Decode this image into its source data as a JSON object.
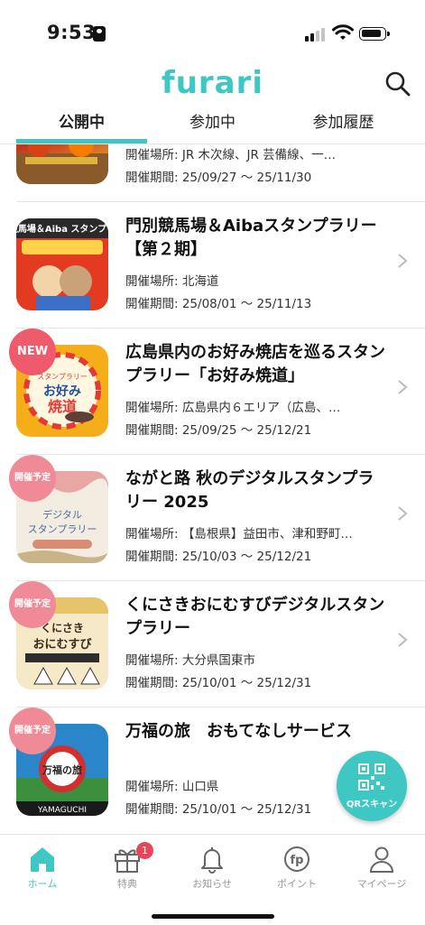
{
  "status_bar": {
    "time": "9:53"
  },
  "header": {
    "logo": "furari"
  },
  "tabs": [
    {
      "label": "公開中",
      "active": true
    },
    {
      "label": "参加中",
      "active": false
    },
    {
      "label": "参加履歴",
      "active": false
    }
  ],
  "rallies": [
    {
      "title": "",
      "place": "開催場所: JR 木次線、JR 芸備線、一…",
      "period": "開催期間: 25/09/27 〜 25/11/30",
      "badge": ""
    },
    {
      "title": "門別競馬場＆Aibaスタンプラリー【第２期】",
      "place": "開催場所: 北海道",
      "period": "開催期間: 25/08/01 〜 25/11/13",
      "badge": "",
      "thumb_text": "門別競馬場＆Aiba スタンプラリー"
    },
    {
      "title": "広島県内のお好み焼店を巡るスタンプラリー「お好み焼道」",
      "place": "開催場所: 広島県内６エリア（広島、…",
      "period": "開催期間: 25/09/25 〜 25/12/21",
      "badge": "NEW",
      "thumb_text": "スタンプラリー お好み焼道"
    },
    {
      "title": "ながと路 秋のデジタルスタンプラリー 2025",
      "place": "開催場所: 【島根県】益田市、津和野町…",
      "period": "開催期間: 25/10/03 〜 25/12/21",
      "badge": "開催予定",
      "thumb_text": "デジタル スタンプラリー"
    },
    {
      "title": "くにさきおにむすびデジタルスタンプラリー",
      "place": "開催場所: 大分県国東市",
      "period": "開催期間: 25/10/01 〜 25/12/31",
      "badge": "開催予定",
      "thumb_text": "くにさき おにむすび"
    },
    {
      "title": "万福の旅　おもてなしサービス",
      "place": "開催場所: 山口県",
      "period": "開催期間: 25/10/01 〜 25/12/31",
      "badge": "開催予定",
      "thumb_text": "万福の旅 YAMAGUCHI"
    }
  ],
  "qr_button": {
    "label": "QRスキャン"
  },
  "bottom_nav": [
    {
      "label": "ホーム",
      "icon": "home-icon",
      "active": true
    },
    {
      "label": "特典",
      "icon": "gift-icon",
      "badge": "1"
    },
    {
      "label": "お知らせ",
      "icon": "bell-icon"
    },
    {
      "label": "ポイント",
      "icon": "points-icon"
    },
    {
      "label": "マイページ",
      "icon": "person-icon"
    }
  ],
  "colors": {
    "accent": "#3fc8c3",
    "badge_new": "#ef5a6c",
    "badge_soon": "#ef8a96"
  }
}
